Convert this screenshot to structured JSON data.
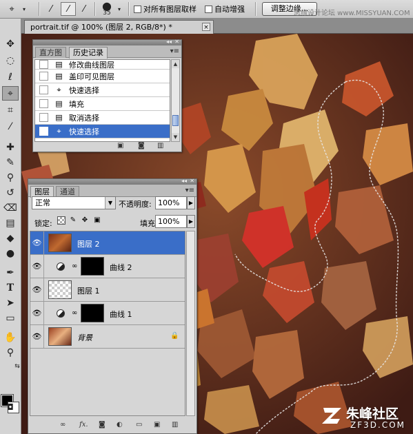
{
  "options_bar": {
    "brush_size": "35",
    "sample_all_layers_label": "对所有图层取样",
    "auto_enhance_label": "自动增强",
    "refine_edge_label": "调整边缘...",
    "site_watermark": "思缘设计论坛 www.MISSYUAN.COM"
  },
  "document": {
    "tab_title": "portrait.tif @ 100% (图层 2, RGB/8*) *",
    "close_glyph": "×"
  },
  "history_panel": {
    "tabs": [
      "直方图",
      "历史记录"
    ],
    "active_tab": "历史记录",
    "entries": [
      {
        "label": "修改曲线图层",
        "icon": "document-icon"
      },
      {
        "label": "盖印可见图层",
        "icon": "document-icon"
      },
      {
        "label": "快速选择",
        "icon": "quick-select-icon"
      },
      {
        "label": "填充",
        "icon": "document-icon"
      },
      {
        "label": "取消选择",
        "icon": "document-icon"
      },
      {
        "label": "快速选择",
        "icon": "quick-select-icon",
        "selected": true
      }
    ]
  },
  "layers_panel": {
    "tabs": [
      "图层",
      "通道"
    ],
    "active_tab": "图层",
    "blend_mode": "正常",
    "opacity_label": "不透明度:",
    "opacity_value": "100%",
    "lock_label": "锁定:",
    "fill_label": "填充:",
    "fill_value": "100%",
    "layers": [
      {
        "name": "图层 2",
        "type": "pixel",
        "selected": true
      },
      {
        "name": "曲线 2",
        "type": "curves"
      },
      {
        "name": "图层 1",
        "type": "transparent"
      },
      {
        "name": "曲线 1",
        "type": "curves"
      },
      {
        "name": "背景",
        "type": "background",
        "locked": true
      }
    ]
  },
  "watermark": {
    "name": "朱峰社区",
    "domain": "ZF3D.COM"
  },
  "colors": {
    "selection_blue": "#3a6ec8",
    "foreground": "#000000",
    "background": "#ffffff"
  }
}
